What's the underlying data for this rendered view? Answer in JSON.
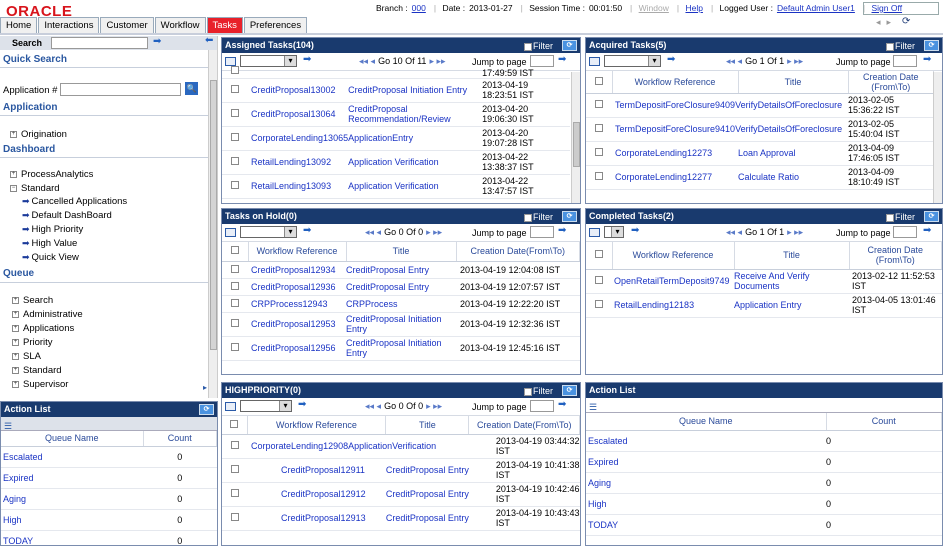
{
  "app": {
    "logo": "ORACLE"
  },
  "header": {
    "branch_label": "Branch :",
    "branch_value": "000",
    "date_label": "Date :",
    "date_value": "2013-01-27",
    "session_label": "Session Time :",
    "session_value": "00:01:50",
    "window": "Window",
    "help": "Help",
    "logged_label": "Logged User :",
    "logged_value": "Default Admin User1",
    "signoff": "Sign Off"
  },
  "tabs": [
    "Home",
    "Interactions",
    "Customer",
    "Workflow",
    "Tasks",
    "Preferences"
  ],
  "left": {
    "search_label": "Search",
    "quick_search": "Quick Search",
    "application_num": "Application #",
    "application": "Application",
    "origination": "Origination",
    "dashboard": "Dashboard",
    "process_analytics": "ProcessAnalytics",
    "standard": "Standard",
    "dash_items": [
      "Cancelled Applications",
      "Default DashBoard",
      "High Priority",
      "High Value",
      "Quick View"
    ],
    "queue": "Queue",
    "queue_items": [
      "Search",
      "Administrative",
      "Applications",
      "Priority",
      "SLA",
      "Standard",
      "Supervisor"
    ]
  },
  "assigned": {
    "title": "Assigned Tasks(104)",
    "filter": "Filter",
    "pager": "Go 10 Of 11",
    "jump": "Jump to page",
    "rows": [
      {
        "ref": "",
        "title": "",
        "date": "17:49:59 IST",
        "date1": ""
      },
      {
        "ref": "CreditProposal13002",
        "title": "CreditProposal Initiation Entry",
        "date1": "2013-04-19",
        "date": "18:23:51 IST"
      },
      {
        "ref": "CreditProposal13064",
        "title": "CreditProposal Recommendation/Review",
        "date1": "2013-04-20",
        "date": "19:06:30 IST"
      },
      {
        "ref": "CorporateLending13065",
        "title": "ApplicationEntry",
        "date1": "2013-04-20",
        "date": "19:07:28 IST"
      },
      {
        "ref": "RetailLending13092",
        "title": "Application Verification",
        "date1": "2013-04-22",
        "date": "13:38:37 IST"
      },
      {
        "ref": "RetailLending13093",
        "title": "Application Verification",
        "date1": "2013-04-22",
        "date": "13:47:57 IST"
      }
    ]
  },
  "acquired": {
    "title": "Acquired Tasks(5)",
    "filter": "Filter",
    "pager": "Go 1 Of 1",
    "jump": "Jump to page",
    "cols": [
      "Workflow Reference",
      "Title",
      "Creation Date (From\\To)"
    ],
    "rows": [
      {
        "ref": "TermDepositForeClosure9409",
        "title": "VerifyDetailsOfForeclosure",
        "date1": "2013-02-05",
        "date": "15:36:22 IST"
      },
      {
        "ref": "TermDepositForeClosure9410",
        "title": "VerifyDetailsOfForeclosure",
        "date1": "2013-02-05",
        "date": "15:40:04 IST"
      },
      {
        "ref": "CorporateLending12273",
        "title": "Loan Approval",
        "date1": "2013-04-09",
        "date": "17:46:05 IST"
      },
      {
        "ref": "CorporateLending12277",
        "title": "Calculate Ratio",
        "date1": "2013-04-09",
        "date": "18:10:49 IST"
      }
    ]
  },
  "onhold": {
    "title": "Tasks on Hold(0)",
    "filter": "Filter",
    "pager": "Go 0 Of 0",
    "jump": "Jump to page",
    "cols": [
      "Workflow Reference",
      "Title",
      "Creation Date(From\\To)"
    ],
    "rows": [
      {
        "ref": "CreditProposal12934",
        "title": "CreditProposal Entry",
        "date": "2013-04-19 12:04:08 IST"
      },
      {
        "ref": "CreditProposal12936",
        "title": "CreditProposal Entry",
        "date": "2013-04-19 12:07:57 IST"
      },
      {
        "ref": "CRPProcess12943",
        "title": "CRPProcess",
        "date": "2013-04-19 12:22:20 IST"
      },
      {
        "ref": "CreditProposal12953",
        "title": "CreditProposal Initiation Entry",
        "date": "2013-04-19 12:32:36 IST"
      },
      {
        "ref": "CreditProposal12956",
        "title": "CreditProposal Initiation Entry",
        "date": "2013-04-19 12:45:16 IST"
      }
    ]
  },
  "completed": {
    "title": "Completed Tasks(2)",
    "filter": "Filter",
    "pager": "Go 1 Of 1",
    "jump": "Jump to page",
    "cols": [
      "Workflow Reference",
      "Title",
      "Creation Date (From\\To)"
    ],
    "rows": [
      {
        "ref": "OpenRetailTermDeposit9749",
        "title": "Receive And Verify Documents",
        "date1": "2013-02-12 11:52:53",
        "date": "IST"
      },
      {
        "ref": "RetailLending12183",
        "title": "Application Entry",
        "date1": "2013-04-05 13:01:46",
        "date": "IST"
      }
    ]
  },
  "highpriority": {
    "title": "HIGHPRIORITY(0)",
    "filter": "Filter",
    "pager": "Go 0 Of 0",
    "jump": "Jump to page",
    "cols": [
      "Workflow Reference",
      "Title",
      "Creation Date(From\\To)"
    ],
    "rows": [
      {
        "ref": "CorporateLending12908",
        "title": "ApplicationVerification",
        "date1": "2013-04-19 03:44:32",
        "date": "IST"
      },
      {
        "ref": "CreditProposal12911",
        "title": "CreditProposal Entry",
        "date1": "2013-04-19 10:41:38",
        "date": "IST"
      },
      {
        "ref": "CreditProposal12912",
        "title": "CreditProposal Entry",
        "date1": "2013-04-19 10:42:46",
        "date": "IST"
      },
      {
        "ref": "CreditProposal12913",
        "title": "CreditProposal Entry",
        "date1": "2013-04-19 10:43:43",
        "date": "IST"
      }
    ]
  },
  "actionlist_left": {
    "title": "Action List",
    "col_queue": "Queue Name",
    "col_count": "Count",
    "rows": [
      {
        "q": "Escalated",
        "c": "0"
      },
      {
        "q": "Expired",
        "c": "0"
      },
      {
        "q": "Aging",
        "c": "0"
      },
      {
        "q": "High",
        "c": "0"
      },
      {
        "q": "TODAY",
        "c": "0"
      }
    ]
  },
  "actionlist_right": {
    "title": "Action List",
    "col_queue": "Queue Name",
    "col_count": "Count",
    "rows": [
      {
        "q": "Escalated",
        "c": "0"
      },
      {
        "q": "Expired",
        "c": "0"
      },
      {
        "q": "Aging",
        "c": "0"
      },
      {
        "q": "High",
        "c": "0"
      },
      {
        "q": "TODAY",
        "c": "0"
      }
    ]
  }
}
